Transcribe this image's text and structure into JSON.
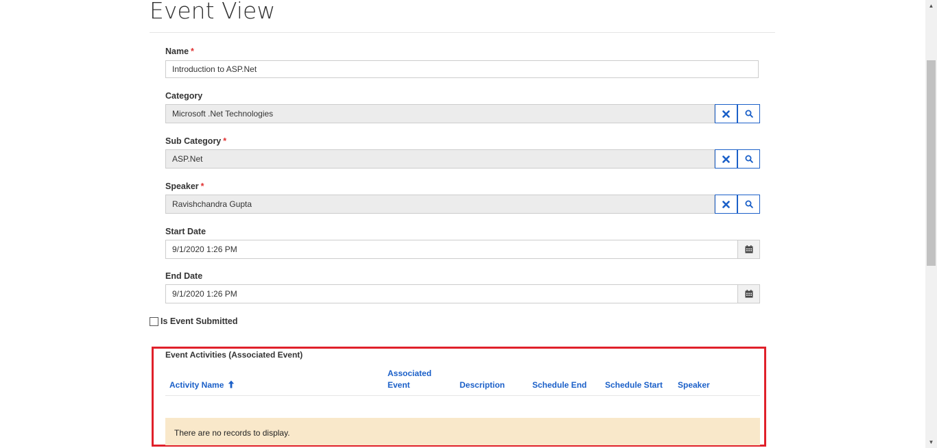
{
  "page": {
    "title": "Event View"
  },
  "form": {
    "name": {
      "label": "Name",
      "required_mark": "*",
      "value": "Introduction to  ASP.Net"
    },
    "category": {
      "label": "Category",
      "value": "Microsoft .Net Technologies"
    },
    "sub_category": {
      "label": "Sub Category",
      "required_mark": "*",
      "value": "ASP.Net"
    },
    "speaker": {
      "label": "Speaker",
      "required_mark": "*",
      "value": "Ravishchandra Gupta"
    },
    "start_date": {
      "label": "Start Date",
      "value": "9/1/2020 1:26 PM"
    },
    "end_date": {
      "label": "End Date",
      "value": "9/1/2020 1:26 PM"
    },
    "is_event_submitted": {
      "label": "Is Event Submitted",
      "checked": false
    }
  },
  "subgrid": {
    "title": "Event Activities (Associated Event)",
    "columns": [
      {
        "label": "Activity Name",
        "sort": "ascending"
      },
      {
        "label_line1": "Associated",
        "label_line2": "Event"
      },
      {
        "label": "Description"
      },
      {
        "label": "Schedule End"
      },
      {
        "label": "Schedule Start"
      },
      {
        "label": "Speaker"
      }
    ],
    "empty_message": "There are no records to display.",
    "highlight_color": "#e0202a",
    "empty_background": "#f9e8ca"
  },
  "icons": {
    "clear": "close-icon",
    "search": "search-icon",
    "calendar": "calendar-icon",
    "sort": "arrow-up-icon"
  },
  "colors": {
    "accent": "#1a5fc8",
    "required": "#e03030"
  }
}
